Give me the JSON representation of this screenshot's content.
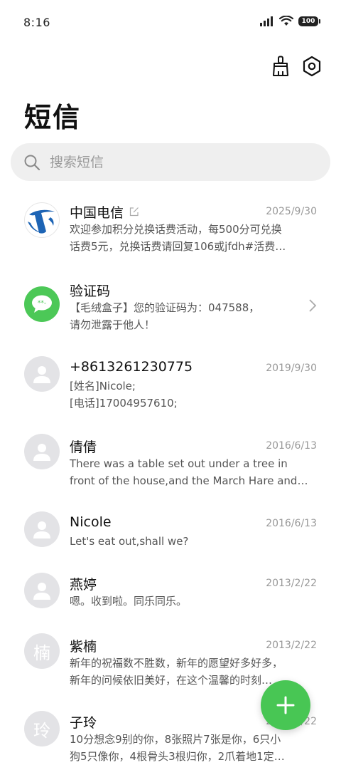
{
  "status": {
    "time": "8:16",
    "battery": "100"
  },
  "header": {
    "title": "短信"
  },
  "search": {
    "placeholder": "搜索短信"
  },
  "conversations": [
    {
      "name": "中国电信",
      "date": "2025/9/30",
      "lines": [
        "欢迎参加积分兑换话费活动，每500分可兑换",
        "话费5元，兑换话费请回复106或jfdh#活费…"
      ],
      "avatar": "telecom-logo"
    },
    {
      "name": "验证码",
      "date": "",
      "lines": [
        "【毛绒盒子】您的验证码为：047588，",
        "请勿泄露于他人！"
      ],
      "avatar": "message-bubble-icon"
    },
    {
      "name": "+8613261230775",
      "date": "2019/9/30",
      "lines": [
        "[姓名]Nicole;",
        "[电话]17004957610;"
      ],
      "avatar": "person-icon"
    },
    {
      "name": "倩倩",
      "date": "2016/6/13",
      "lines": [
        "There was a table set out under a tree in",
        "front of the house,and the March Hare and…"
      ],
      "avatar": "person-icon"
    },
    {
      "name": "Nicole",
      "date": "2016/6/13",
      "lines": [
        "Let's eat out,shall we?"
      ],
      "avatar": "person-icon"
    },
    {
      "name": "燕婷",
      "date": "2013/2/22",
      "lines": [
        "嗯。收到啦。同乐同乐。"
      ],
      "avatar": "person-icon"
    },
    {
      "name": "紫楠",
      "date": "2013/2/22",
      "lines": [
        "新年的祝福数不胜数，新年的愿望好多好多，",
        "新年的问候依旧美好，在这个温馨的时刻…"
      ],
      "avatar_letter": "楠"
    },
    {
      "name": "子玲",
      "date": "2013/2/22",
      "lines": [
        "10分想念9别的你，8张照片7张是你，6只小",
        "狗5只像你，4根骨头3根归你，2爪着地1定…"
      ],
      "avatar_letter": "玲"
    }
  ],
  "colors": {
    "accent_green": "#48c654",
    "avatar_grey": "#e3e3e6",
    "telecom_blue": "#1d64b5"
  },
  "fab": {
    "icon": "plus-icon"
  }
}
